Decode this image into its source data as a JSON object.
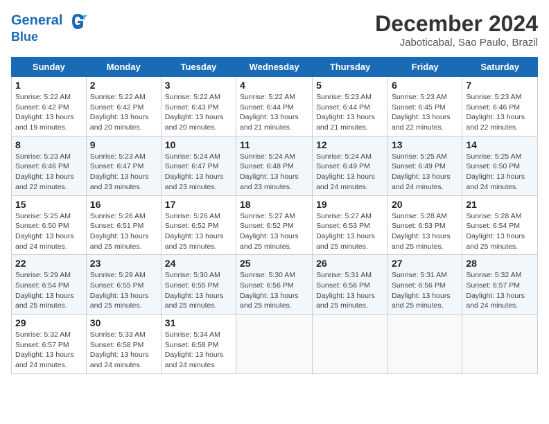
{
  "logo": {
    "line1": "General",
    "line2": "Blue"
  },
  "title": "December 2024",
  "subtitle": "Jaboticabal, Sao Paulo, Brazil",
  "days_of_week": [
    "Sunday",
    "Monday",
    "Tuesday",
    "Wednesday",
    "Thursday",
    "Friday",
    "Saturday"
  ],
  "weeks": [
    [
      {
        "day": "1",
        "detail": "Sunrise: 5:22 AM\nSunset: 6:42 PM\nDaylight: 13 hours\nand 19 minutes."
      },
      {
        "day": "2",
        "detail": "Sunrise: 5:22 AM\nSunset: 6:42 PM\nDaylight: 13 hours\nand 20 minutes."
      },
      {
        "day": "3",
        "detail": "Sunrise: 5:22 AM\nSunset: 6:43 PM\nDaylight: 13 hours\nand 20 minutes."
      },
      {
        "day": "4",
        "detail": "Sunrise: 5:22 AM\nSunset: 6:44 PM\nDaylight: 13 hours\nand 21 minutes."
      },
      {
        "day": "5",
        "detail": "Sunrise: 5:23 AM\nSunset: 6:44 PM\nDaylight: 13 hours\nand 21 minutes."
      },
      {
        "day": "6",
        "detail": "Sunrise: 5:23 AM\nSunset: 6:45 PM\nDaylight: 13 hours\nand 22 minutes."
      },
      {
        "day": "7",
        "detail": "Sunrise: 5:23 AM\nSunset: 6:46 PM\nDaylight: 13 hours\nand 22 minutes."
      }
    ],
    [
      {
        "day": "8",
        "detail": "Sunrise: 5:23 AM\nSunset: 6:46 PM\nDaylight: 13 hours\nand 22 minutes."
      },
      {
        "day": "9",
        "detail": "Sunrise: 5:23 AM\nSunset: 6:47 PM\nDaylight: 13 hours\nand 23 minutes."
      },
      {
        "day": "10",
        "detail": "Sunrise: 5:24 AM\nSunset: 6:47 PM\nDaylight: 13 hours\nand 23 minutes."
      },
      {
        "day": "11",
        "detail": "Sunrise: 5:24 AM\nSunset: 6:48 PM\nDaylight: 13 hours\nand 23 minutes."
      },
      {
        "day": "12",
        "detail": "Sunrise: 5:24 AM\nSunset: 6:49 PM\nDaylight: 13 hours\nand 24 minutes."
      },
      {
        "day": "13",
        "detail": "Sunrise: 5:25 AM\nSunset: 6:49 PM\nDaylight: 13 hours\nand 24 minutes."
      },
      {
        "day": "14",
        "detail": "Sunrise: 5:25 AM\nSunset: 6:50 PM\nDaylight: 13 hours\nand 24 minutes."
      }
    ],
    [
      {
        "day": "15",
        "detail": "Sunrise: 5:25 AM\nSunset: 6:50 PM\nDaylight: 13 hours\nand 24 minutes."
      },
      {
        "day": "16",
        "detail": "Sunrise: 5:26 AM\nSunset: 6:51 PM\nDaylight: 13 hours\nand 25 minutes."
      },
      {
        "day": "17",
        "detail": "Sunrise: 5:26 AM\nSunset: 6:52 PM\nDaylight: 13 hours\nand 25 minutes."
      },
      {
        "day": "18",
        "detail": "Sunrise: 5:27 AM\nSunset: 6:52 PM\nDaylight: 13 hours\nand 25 minutes."
      },
      {
        "day": "19",
        "detail": "Sunrise: 5:27 AM\nSunset: 6:53 PM\nDaylight: 13 hours\nand 25 minutes."
      },
      {
        "day": "20",
        "detail": "Sunrise: 5:28 AM\nSunset: 6:53 PM\nDaylight: 13 hours\nand 25 minutes."
      },
      {
        "day": "21",
        "detail": "Sunrise: 5:28 AM\nSunset: 6:54 PM\nDaylight: 13 hours\nand 25 minutes."
      }
    ],
    [
      {
        "day": "22",
        "detail": "Sunrise: 5:29 AM\nSunset: 6:54 PM\nDaylight: 13 hours\nand 25 minutes."
      },
      {
        "day": "23",
        "detail": "Sunrise: 5:29 AM\nSunset: 6:55 PM\nDaylight: 13 hours\nand 25 minutes."
      },
      {
        "day": "24",
        "detail": "Sunrise: 5:30 AM\nSunset: 6:55 PM\nDaylight: 13 hours\nand 25 minutes."
      },
      {
        "day": "25",
        "detail": "Sunrise: 5:30 AM\nSunset: 6:56 PM\nDaylight: 13 hours\nand 25 minutes."
      },
      {
        "day": "26",
        "detail": "Sunrise: 5:31 AM\nSunset: 6:56 PM\nDaylight: 13 hours\nand 25 minutes."
      },
      {
        "day": "27",
        "detail": "Sunrise: 5:31 AM\nSunset: 6:56 PM\nDaylight: 13 hours\nand 25 minutes."
      },
      {
        "day": "28",
        "detail": "Sunrise: 5:32 AM\nSunset: 6:57 PM\nDaylight: 13 hours\nand 24 minutes."
      }
    ],
    [
      {
        "day": "29",
        "detail": "Sunrise: 5:32 AM\nSunset: 6:57 PM\nDaylight: 13 hours\nand 24 minutes."
      },
      {
        "day": "30",
        "detail": "Sunrise: 5:33 AM\nSunset: 6:58 PM\nDaylight: 13 hours\nand 24 minutes."
      },
      {
        "day": "31",
        "detail": "Sunrise: 5:34 AM\nSunset: 6:58 PM\nDaylight: 13 hours\nand 24 minutes."
      },
      {
        "day": "",
        "detail": ""
      },
      {
        "day": "",
        "detail": ""
      },
      {
        "day": "",
        "detail": ""
      },
      {
        "day": "",
        "detail": ""
      }
    ]
  ]
}
